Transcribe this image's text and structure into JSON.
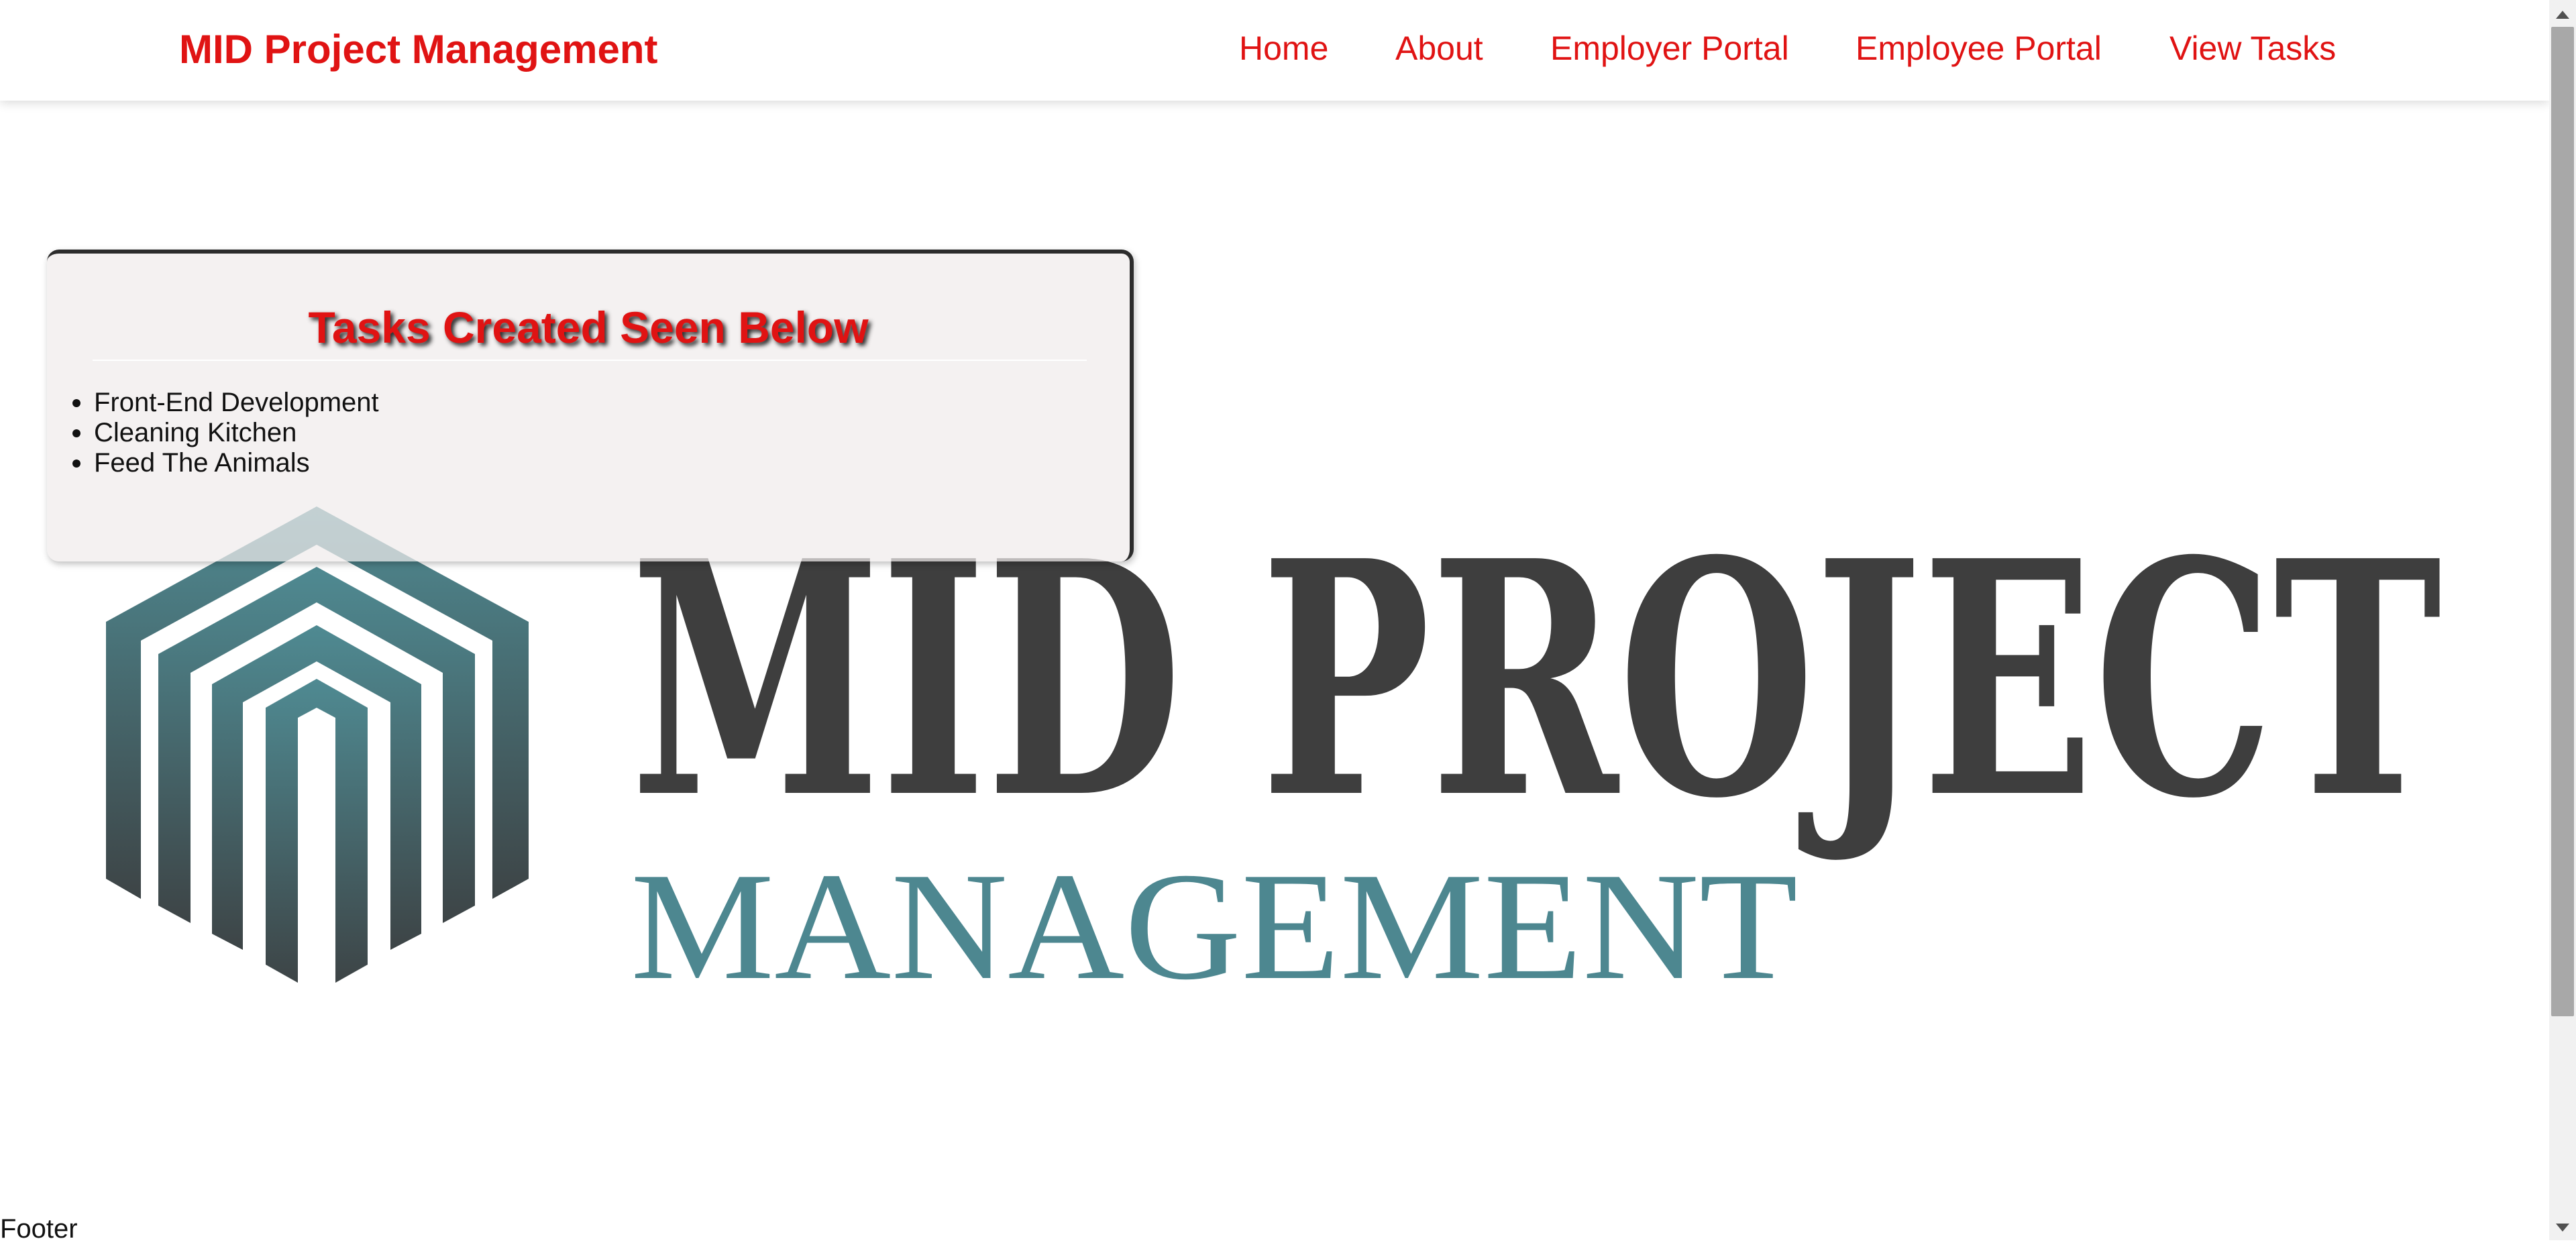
{
  "header": {
    "brand": "MID Project Management",
    "nav": [
      {
        "label": "Home"
      },
      {
        "label": "About"
      },
      {
        "label": "Employer Portal"
      },
      {
        "label": "Employee Portal"
      },
      {
        "label": "View Tasks"
      }
    ]
  },
  "tasks_panel": {
    "title": "Tasks Created Seen Below",
    "items": [
      "Front-End Development",
      "Cleaning Kitchen",
      "Feed The Animals"
    ]
  },
  "logo": {
    "line1": "MID PROJECT",
    "line2": "MANAGEMENT"
  },
  "footer": {
    "text": "Footer"
  },
  "colors": {
    "brand_red": "#e01313",
    "logo_dark": "#3e3e3e",
    "logo_teal": "#4d8790"
  }
}
